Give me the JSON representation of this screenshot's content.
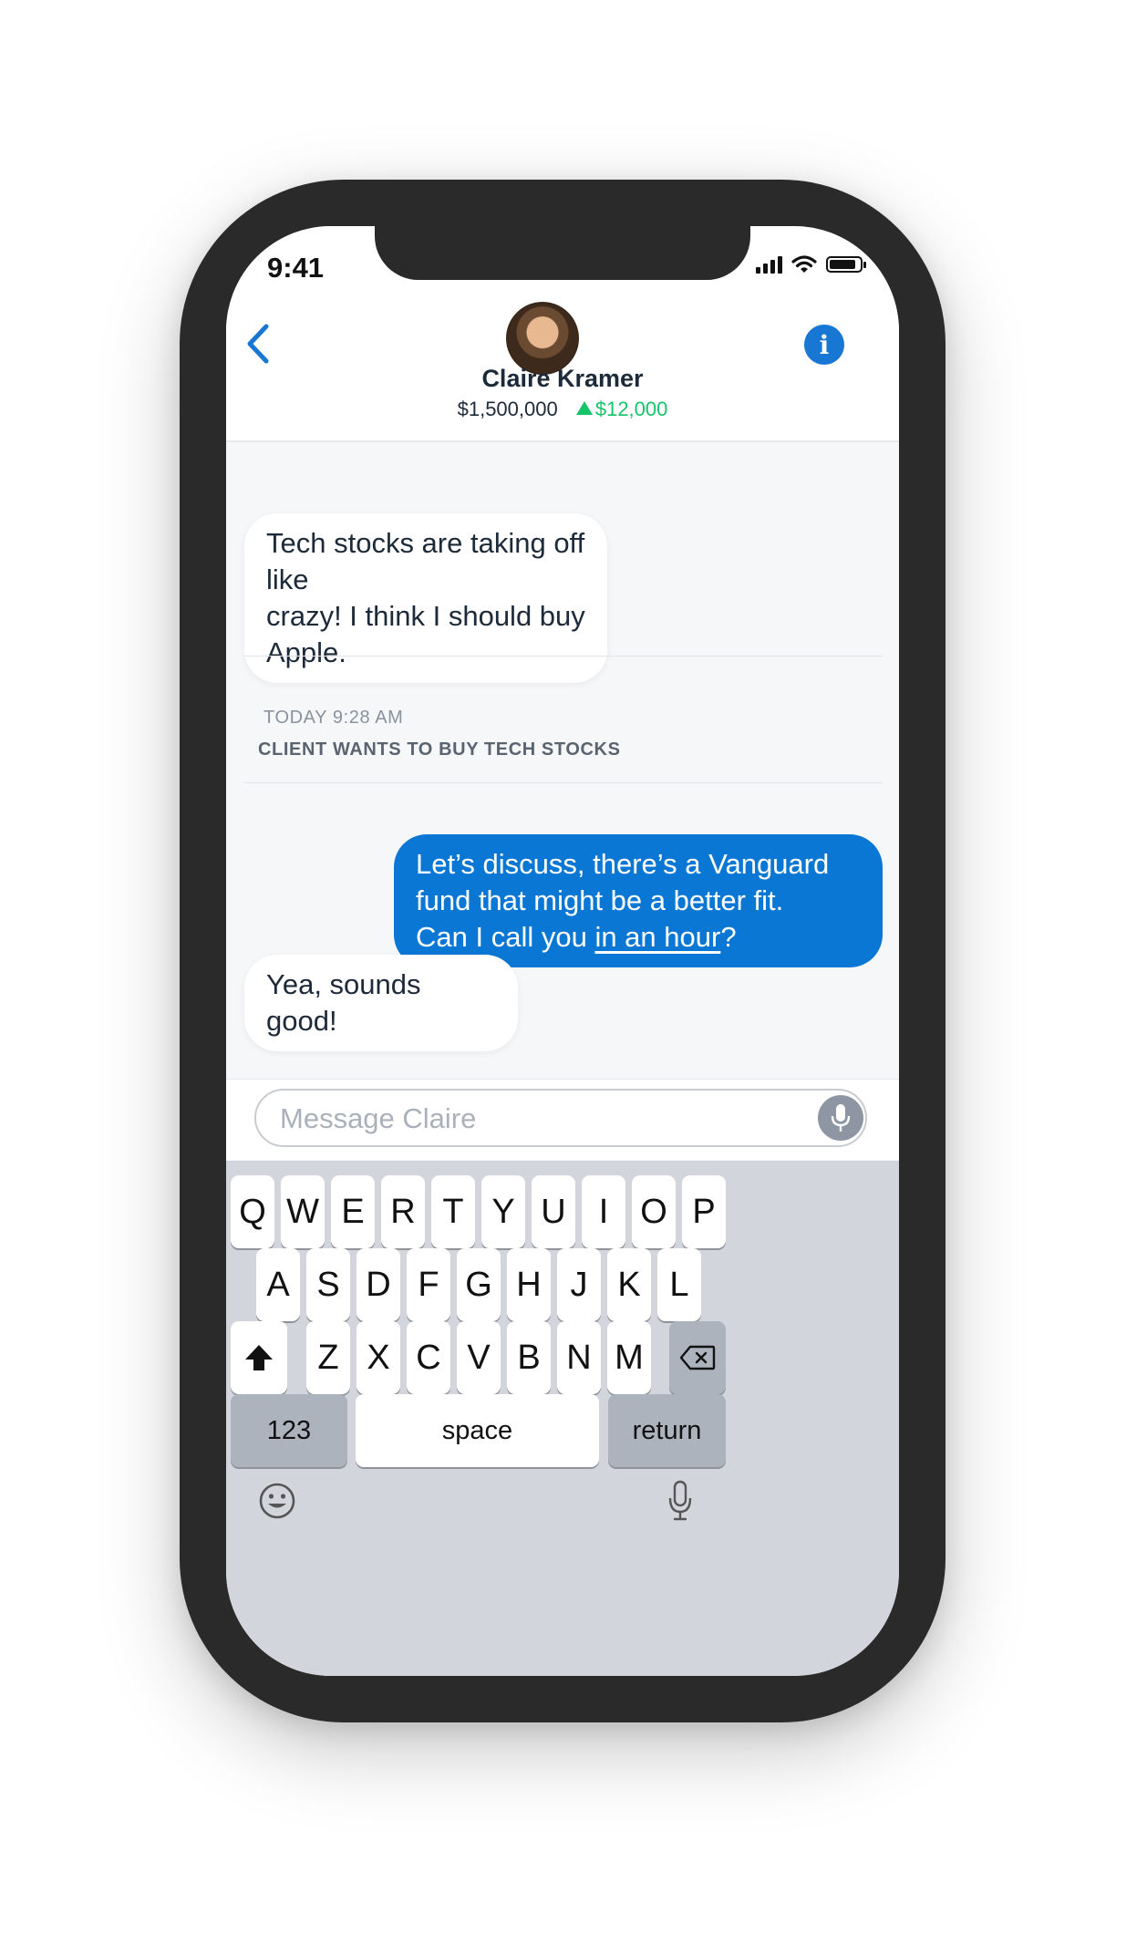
{
  "status": {
    "time": "9:41"
  },
  "header": {
    "contact_name": "Claire Kramer",
    "portfolio_value": "$1,500,000",
    "portfolio_change": "$12,000",
    "change_direction": "up",
    "back_icon": "chevron-left-icon",
    "info_icon": "info-icon"
  },
  "messages": [
    {
      "from": "client",
      "text_lines": [
        "Tech stocks are taking off like",
        "crazy! I think I should buy Apple."
      ]
    },
    {
      "from": "advisor",
      "text_lines": [
        "Let’s discuss, there’s a Vanguard",
        "fund that might be a better fit."
      ],
      "last_line_prefix": "Can I call you ",
      "last_line_link": "in an hour",
      "last_line_suffix": "?"
    },
    {
      "from": "client",
      "text_lines": [
        "Yea, sounds good!"
      ]
    }
  ],
  "note": {
    "timestamp": "TODAY 9:28 AM",
    "text": "CLIENT WANTS TO BUY TECH STOCKS"
  },
  "composer": {
    "placeholder": "Message Claire",
    "mic_icon": "microphone-icon"
  },
  "keyboard": {
    "row1": [
      "Q",
      "W",
      "E",
      "R",
      "T",
      "Y",
      "U",
      "I",
      "O",
      "P"
    ],
    "row2": [
      "A",
      "S",
      "D",
      "F",
      "G",
      "H",
      "J",
      "K",
      "L"
    ],
    "row3": [
      "Z",
      "X",
      "C",
      "V",
      "B",
      "N",
      "M"
    ],
    "numbers_label": "123",
    "space_label": "space",
    "return_label": "return",
    "shift_icon": "shift-icon",
    "delete_icon": "backspace-icon",
    "emoji_icon": "emoji-icon",
    "dictation_icon": "microphone-icon"
  },
  "colors": {
    "accent": "#0b77d5",
    "gain": "#17c46a",
    "frame": "#2a2a2a"
  }
}
